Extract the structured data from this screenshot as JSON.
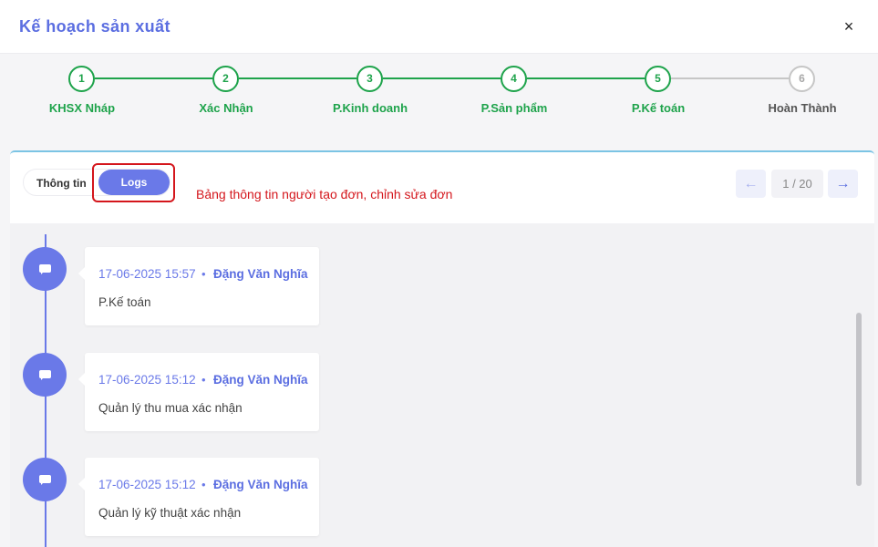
{
  "header": {
    "title": "Kế hoạch sản xuất",
    "close_label": "×"
  },
  "stepper": {
    "steps": [
      {
        "number": "1",
        "label": "KHSX Nháp",
        "status": "done"
      },
      {
        "number": "2",
        "label": "Xác Nhận",
        "status": "done"
      },
      {
        "number": "3",
        "label": "P.Kinh doanh",
        "status": "done"
      },
      {
        "number": "4",
        "label": "P.Sản phẩm",
        "status": "done"
      },
      {
        "number": "5",
        "label": "P.Kế toán",
        "status": "current"
      },
      {
        "number": "6",
        "label": "Hoàn Thành",
        "status": "pending"
      }
    ],
    "active_color": "#1ea34b",
    "pending_color": "#c6c6c6"
  },
  "tabs": {
    "info_label": "Thông tin",
    "logs_label": "Logs",
    "selected": "Logs"
  },
  "annotation": "Bảng thông tin người tạo đơn, chỉnh sửa đơn",
  "pager": {
    "prev_icon": "arrow-left-icon",
    "next_icon": "arrow-right-icon",
    "indicator": "1 / 20"
  },
  "logs": [
    {
      "time": "17-06-2025 15:57",
      "separator": "•",
      "author": "Đặng Văn Nghĩa",
      "action": "P.Kế toán"
    },
    {
      "time": "17-06-2025 15:12",
      "separator": "•",
      "author": "Đặng Văn Nghĩa",
      "action": "Quản lý thu mua xác nhận"
    },
    {
      "time": "17-06-2025 15:12",
      "separator": "•",
      "author": "Đặng Văn Nghĩa",
      "action": "Quản lý kỹ thuật xác nhận"
    }
  ],
  "colors": {
    "accent": "#6a79e8",
    "title": "#5b6ee1",
    "annotation": "#d4161c"
  }
}
